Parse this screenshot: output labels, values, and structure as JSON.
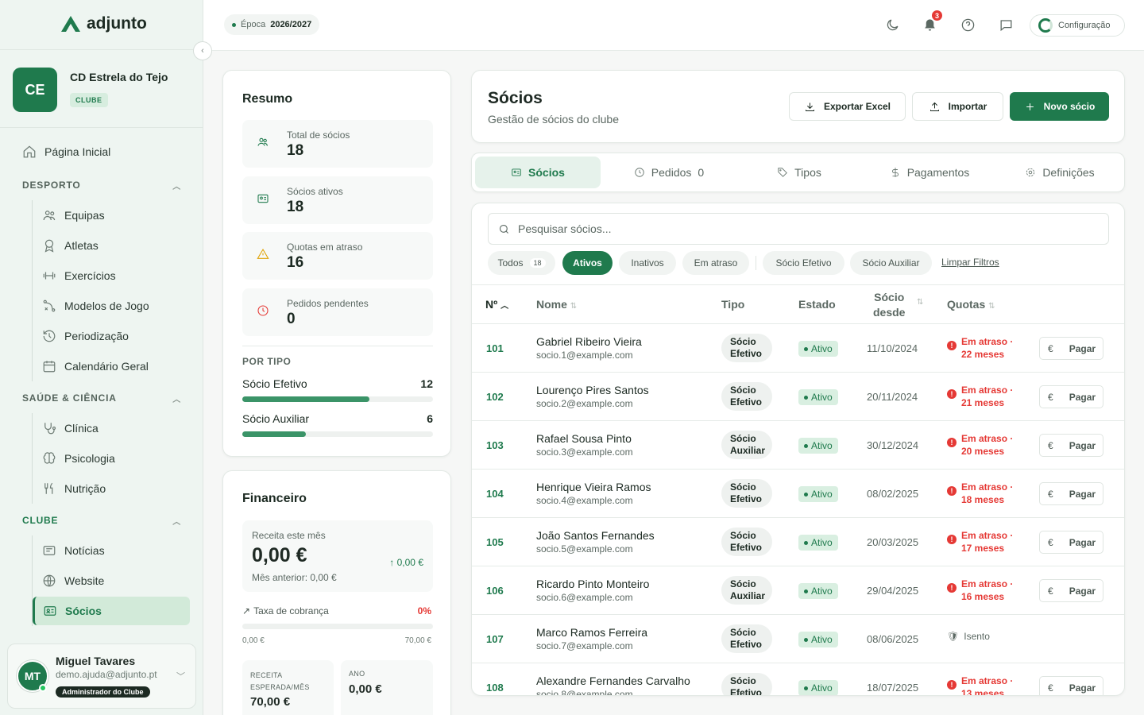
{
  "brand": {
    "name": "adjunto"
  },
  "club": {
    "initials": "CE",
    "name": "CD Estrela do Tejo",
    "tag": "CLUBE"
  },
  "nav": {
    "home": "Página Inicial",
    "sections": [
      {
        "title": "DESPORTO",
        "items": [
          "Equipas",
          "Atletas",
          "Exercícios",
          "Modelos de Jogo",
          "Periodização",
          "Calendário Geral"
        ]
      },
      {
        "title": "SAÚDE & CIÊNCIA",
        "items": [
          "Clínica",
          "Psicologia",
          "Nutrição"
        ]
      },
      {
        "title": "CLUBE",
        "items": [
          "Notícias",
          "Website",
          "Sócios"
        ]
      }
    ]
  },
  "user": {
    "initials": "MT",
    "name": "Miguel Tavares",
    "email": "demo.ajuda@adjunto.pt",
    "role": "Administrador do Clube"
  },
  "topbar": {
    "season_label": "Época",
    "season_value": "2026/2027",
    "notifications": "3",
    "config_label": "Configuração"
  },
  "summary": {
    "title": "Resumo",
    "stats": [
      {
        "label": "Total de sócios",
        "value": "18"
      },
      {
        "label": "Sócios ativos",
        "value": "18"
      },
      {
        "label": "Quotas em atraso",
        "value": "16"
      },
      {
        "label": "Pedidos pendentes",
        "value": "0"
      }
    ],
    "by_type_title": "POR TIPO",
    "types": [
      {
        "name": "Sócio Efetivo",
        "count": "12",
        "fraction": 0.667
      },
      {
        "name": "Sócio Auxiliar",
        "count": "6",
        "fraction": 0.333
      }
    ]
  },
  "finance": {
    "title": "Financeiro",
    "revenue_label": "Receita este mês",
    "revenue_value": "0,00 €",
    "delta": "0,00 €",
    "previous": "Mês anterior: 0,00 €",
    "collection_label": "Taxa de cobrança",
    "collection_value": "0%",
    "range_min": "0,00 €",
    "range_max": "70,00 €",
    "expected_label": "RECEITA ESPERADA/MÊS",
    "expected_value": "70,00 €",
    "year_label": "ANO",
    "year_value": "0,00 €"
  },
  "header": {
    "title": "Sócios",
    "subtitle": "Gestão de sócios do clube",
    "export": "Exportar Excel",
    "import": "Importar",
    "new": "Novo sócio"
  },
  "tabs": [
    {
      "label": "Sócios",
      "count": ""
    },
    {
      "label": "Pedidos",
      "count": "0"
    },
    {
      "label": "Tipos",
      "count": ""
    },
    {
      "label": "Pagamentos",
      "count": ""
    },
    {
      "label": "Definições",
      "count": ""
    }
  ],
  "search": {
    "placeholder": "Pesquisar sócios..."
  },
  "filters": {
    "all": "Todos",
    "all_count": "18",
    "active": "Ativos",
    "inactive": "Inativos",
    "late": "Em atraso",
    "type1": "Sócio Efetivo",
    "type2": "Sócio Auxiliar",
    "clear": "Limpar Filtros"
  },
  "table": {
    "columns": {
      "no": "Nº",
      "name": "Nome",
      "type": "Tipo",
      "status": "Estado",
      "since1": "Sócio",
      "since2": "desde",
      "fees": "Quotas"
    },
    "pay_label": "Pagar",
    "rows": [
      {
        "no": "101",
        "name": "Gabriel Ribeiro Vieira",
        "email": "socio.1@example.com",
        "type1": "Sócio",
        "type2": "Efetivo",
        "status": "Ativo",
        "since": "11/10/2024",
        "fee1": "Em atraso ·",
        "fee2": "22 meses"
      },
      {
        "no": "102",
        "name": "Lourenço Pires Santos",
        "email": "socio.2@example.com",
        "type1": "Sócio",
        "type2": "Efetivo",
        "status": "Ativo",
        "since": "20/11/2024",
        "fee1": "Em atraso ·",
        "fee2": "21 meses"
      },
      {
        "no": "103",
        "name": "Rafael Sousa Pinto",
        "email": "socio.3@example.com",
        "type1": "Sócio",
        "type2": "Auxiliar",
        "status": "Ativo",
        "since": "30/12/2024",
        "fee1": "Em atraso ·",
        "fee2": "20 meses"
      },
      {
        "no": "104",
        "name": "Henrique Vieira Ramos",
        "email": "socio.4@example.com",
        "type1": "Sócio",
        "type2": "Efetivo",
        "status": "Ativo",
        "since": "08/02/2025",
        "fee1": "Em atraso ·",
        "fee2": "18 meses"
      },
      {
        "no": "105",
        "name": "João Santos Fernandes",
        "email": "socio.5@example.com",
        "type1": "Sócio",
        "type2": "Efetivo",
        "status": "Ativo",
        "since": "20/03/2025",
        "fee1": "Em atraso ·",
        "fee2": "17 meses"
      },
      {
        "no": "106",
        "name": "Ricardo Pinto Monteiro",
        "email": "socio.6@example.com",
        "type1": "Sócio",
        "type2": "Auxiliar",
        "status": "Ativo",
        "since": "29/04/2025",
        "fee1": "Em atraso ·",
        "fee2": "16 meses"
      },
      {
        "no": "107",
        "name": "Marco Ramos Ferreira",
        "email": "socio.7@example.com",
        "type1": "Sócio",
        "type2": "Efetivo",
        "status": "Ativo",
        "since": "08/06/2025",
        "exempt": "Isento"
      },
      {
        "no": "108",
        "name": "Alexandre Fernandes Carvalho",
        "email": "socio.8@example.com",
        "type1": "Sócio",
        "type2": "Efetivo",
        "status": "Ativo",
        "since": "18/07/2025",
        "fee1": "Em atraso ·",
        "fee2": "13 meses"
      }
    ]
  }
}
